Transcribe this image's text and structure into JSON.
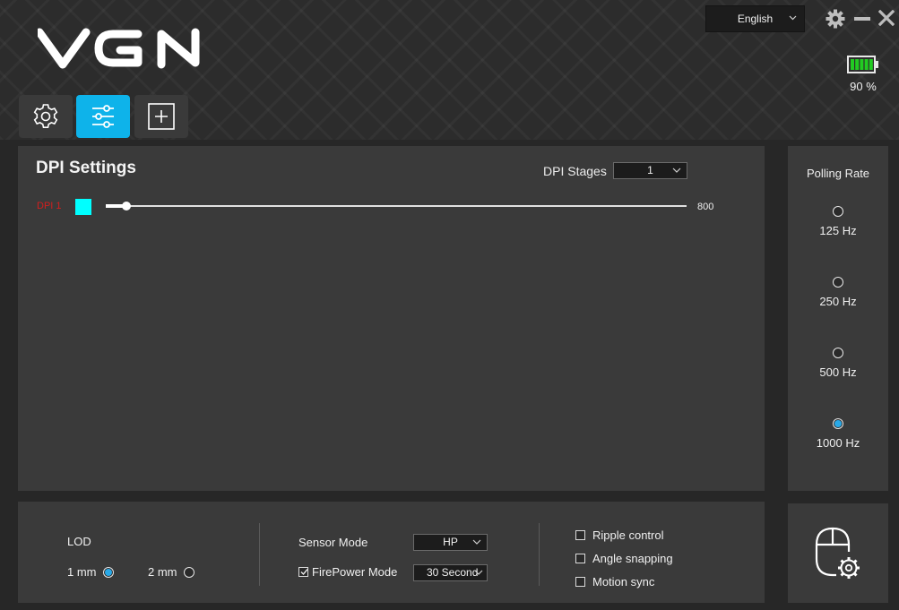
{
  "header": {
    "logo_text": "VGN",
    "language": "English",
    "battery": {
      "percent_text": "90 %",
      "level": 0.9,
      "color": "#22cc22"
    }
  },
  "tabs": [
    {
      "icon": "gear-icon",
      "active": false
    },
    {
      "icon": "sliders-icon",
      "active": true
    },
    {
      "icon": "plus-square-icon",
      "active": false
    }
  ],
  "dpi": {
    "title": "DPI Settings",
    "stages_label": "DPI Stages",
    "stages_value": "1",
    "rows": [
      {
        "label": "DPI 1",
        "color": "#00ffff",
        "value": "800",
        "slider_fraction": 0.035
      }
    ]
  },
  "polling": {
    "title": "Polling Rate",
    "options": [
      {
        "label": "125 Hz",
        "selected": false
      },
      {
        "label": "250 Hz",
        "selected": false
      },
      {
        "label": "500 Hz",
        "selected": false
      },
      {
        "label": "1000 Hz",
        "selected": true
      }
    ]
  },
  "lod": {
    "title": "LOD",
    "options": [
      {
        "label": "1 mm",
        "selected": true
      },
      {
        "label": "2 mm",
        "selected": false
      }
    ]
  },
  "sensor": {
    "mode_label": "Sensor Mode",
    "mode_value": "HP",
    "firepower_label": "FirePower Mode",
    "firepower_checked": true,
    "firepower_value": "30 Second"
  },
  "checkboxes": [
    {
      "label": "Ripple control",
      "checked": false
    },
    {
      "label": "Angle snapping",
      "checked": false
    },
    {
      "label": "Motion sync",
      "checked": false
    }
  ],
  "colors": {
    "accent": "#0eb3ea",
    "radio_selected": "#29a9e8",
    "dpi_label": "#d21e1e"
  }
}
